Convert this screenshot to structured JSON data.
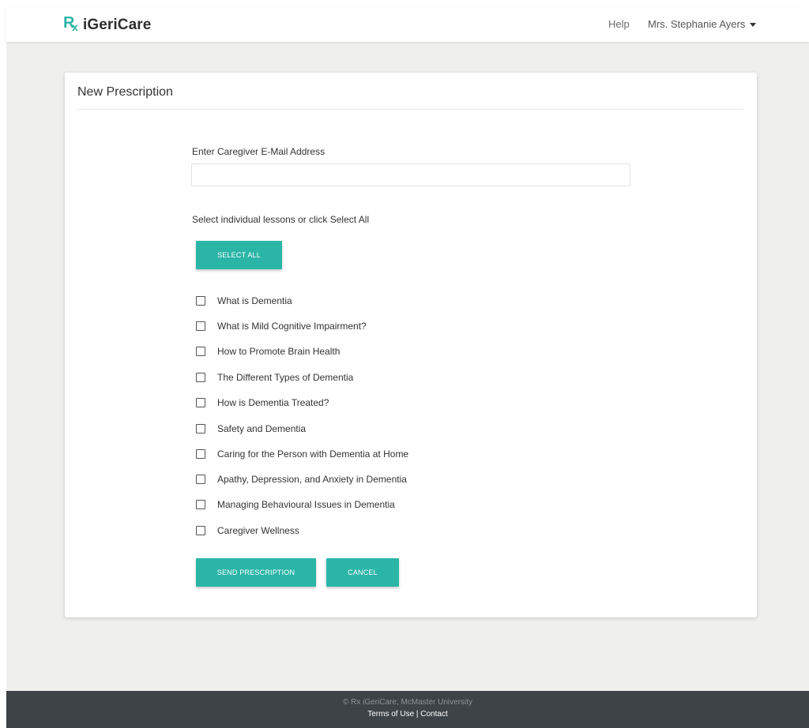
{
  "navbar": {
    "brand_mark": "R",
    "brand_mark_sub": "x",
    "brand_name": "iGeriCare",
    "help_label": "Help",
    "user_name": "Mrs. Stephanie Ayers"
  },
  "card": {
    "title": "New Prescription",
    "email_label": "Enter Caregiver E-Mail Address",
    "email_value": "",
    "select_hint": "Select individual lessons or click Select All",
    "select_all_label": "SELECT ALL",
    "lessons": [
      {
        "label": "What is Dementia",
        "checked": false
      },
      {
        "label": "What is Mild Cognitive Impairment?",
        "checked": false
      },
      {
        "label": "How to Promote Brain Health",
        "checked": false
      },
      {
        "label": "The Different Types of Dementia",
        "checked": false
      },
      {
        "label": "How is Dementia Treated?",
        "checked": false
      },
      {
        "label": "Safety and Dementia",
        "checked": false
      },
      {
        "label": "Caring for the Person with Dementia at Home",
        "checked": false
      },
      {
        "label": "Apathy, Depression, and Anxiety in Dementia",
        "checked": false
      },
      {
        "label": "Managing Behavioural Issues in Dementia",
        "checked": false
      },
      {
        "label": "Caregiver Wellness",
        "checked": false
      }
    ],
    "send_label": "SEND PRESCRIPTION",
    "cancel_label": "CANCEL"
  },
  "footer": {
    "copyright": "© Rx iGeriCare, McMaster University",
    "terms_label": "Terms of Use",
    "separator": " | ",
    "contact_label": "Contact"
  },
  "colors": {
    "accent": "#2bb5a7",
    "footer_bg": "#3e4347",
    "page_bg": "#efefee"
  }
}
